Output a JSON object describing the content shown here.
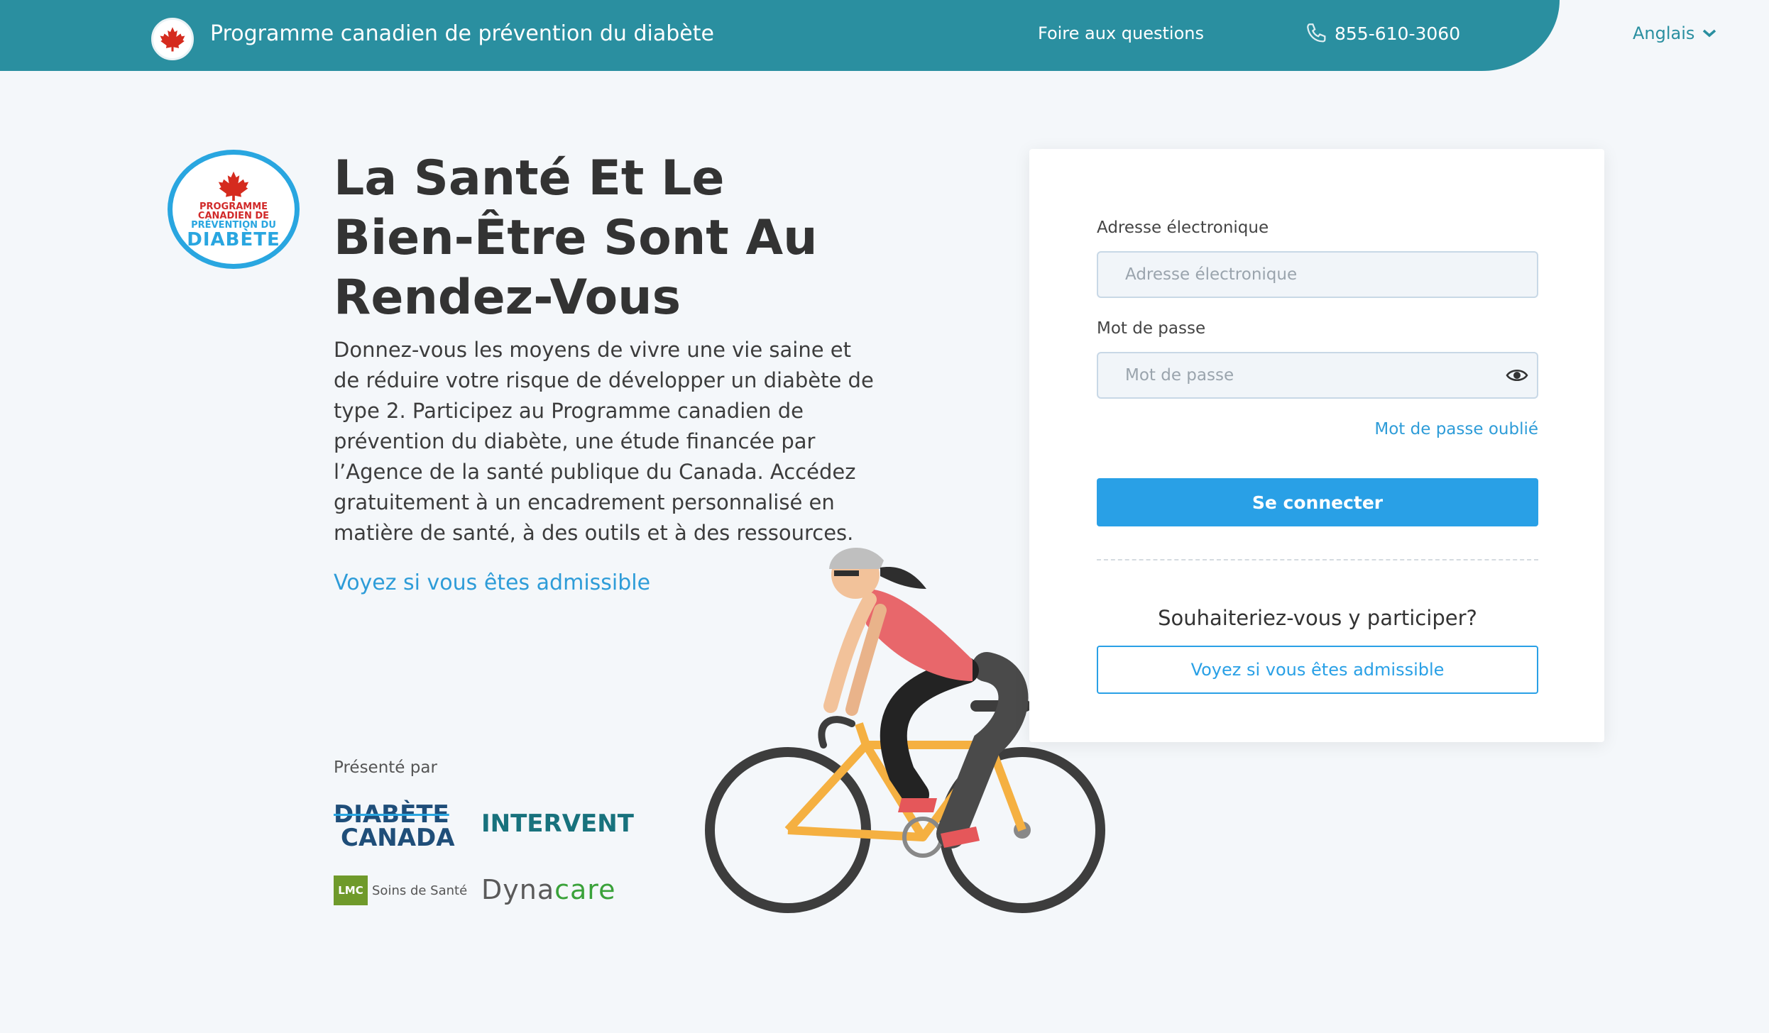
{
  "header": {
    "title": "Programme canadien de prévention du diabète",
    "faq": "Foire aux questions",
    "phone": "855-610-3060",
    "language": "Anglais",
    "brand_color": "#2a8fa0"
  },
  "hero": {
    "logo": {
      "line1": "PROGRAMME",
      "line2": "CANADIEN DE",
      "line3": "PRÉVENTION DU",
      "line4": "DIABÈTE"
    },
    "headline": "La Santé Et Le Bien-Être Sont Au Rendez-Vous",
    "description": "Donnez-vous les moyens de vivre une vie saine et de réduire votre risque de développer un diabète de type 2. Participez au Programme canadien de prévention du diabète, une étude financée par l’Agence de la santé publique du Canada. Accédez gratuitement à un encadrement personnalisé en matière de santé, à des outils et à des ressources.",
    "eligibility_link": "Voyez si vous êtes admissible"
  },
  "partners": {
    "label": "Présenté par",
    "diabete_line1": "DIABÈTE",
    "diabete_line2": "CANADA",
    "intervent": "INTERVENT",
    "lmc_badge": "LMC",
    "lmc_text": "Soins de Santé",
    "dynacare_a": "Dyna",
    "dynacare_b": "care"
  },
  "login": {
    "email_label": "Adresse électronique",
    "email_placeholder": "Adresse électronique",
    "password_label": "Mot de passe",
    "password_placeholder": "Mot de passe",
    "forgot": "Mot de passe oublié",
    "submit": "Se connecter",
    "join_question": "Souhaiteriez-vous y participer?",
    "join_button": "Voyez si vous êtes admissible",
    "accent_color": "#29a0e6"
  },
  "icons": {
    "header_logo": "maple-leaf-icon",
    "phone": "phone-icon",
    "language": "chevron-down-icon",
    "password": "eye-icon"
  }
}
